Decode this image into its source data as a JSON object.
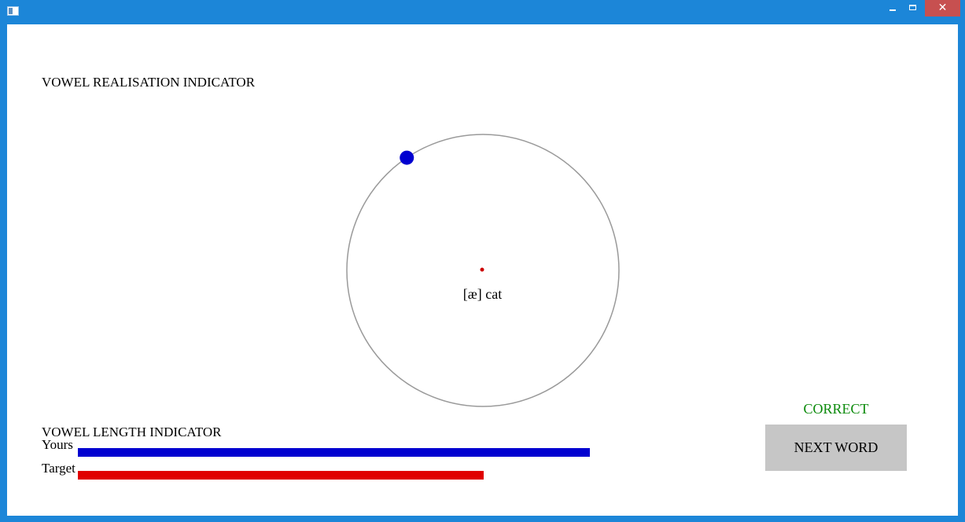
{
  "window": {
    "controls": {
      "minimize": "–",
      "maximize": "",
      "close": "✕"
    },
    "icons": {
      "app": "app-window-icon",
      "minimize": "minimize-icon",
      "maximize": "maximize-icon",
      "close": "close-icon"
    },
    "colors": {
      "titlebar": "#1c86d8",
      "close": "#c75050"
    }
  },
  "realisation": {
    "title": "VOWEL REALISATION INDICATOR",
    "vowel_label": "[æ] cat",
    "marker_angle_deg": 124,
    "colors": {
      "ring": "#9a9a9a",
      "marker": "#0000d0",
      "target_dot": "#cc0000"
    }
  },
  "length": {
    "title": "VOWEL LENGTH INDICATOR",
    "yours_label": "Yours",
    "target_label": "Target",
    "yours_ratio": 0.85,
    "target_ratio": 0.673,
    "colors": {
      "yours": "#0000d0",
      "target": "#e00000"
    }
  },
  "result": {
    "status": "CORRECT",
    "status_color": "#0a8a0a",
    "next_button": "NEXT WORD"
  }
}
